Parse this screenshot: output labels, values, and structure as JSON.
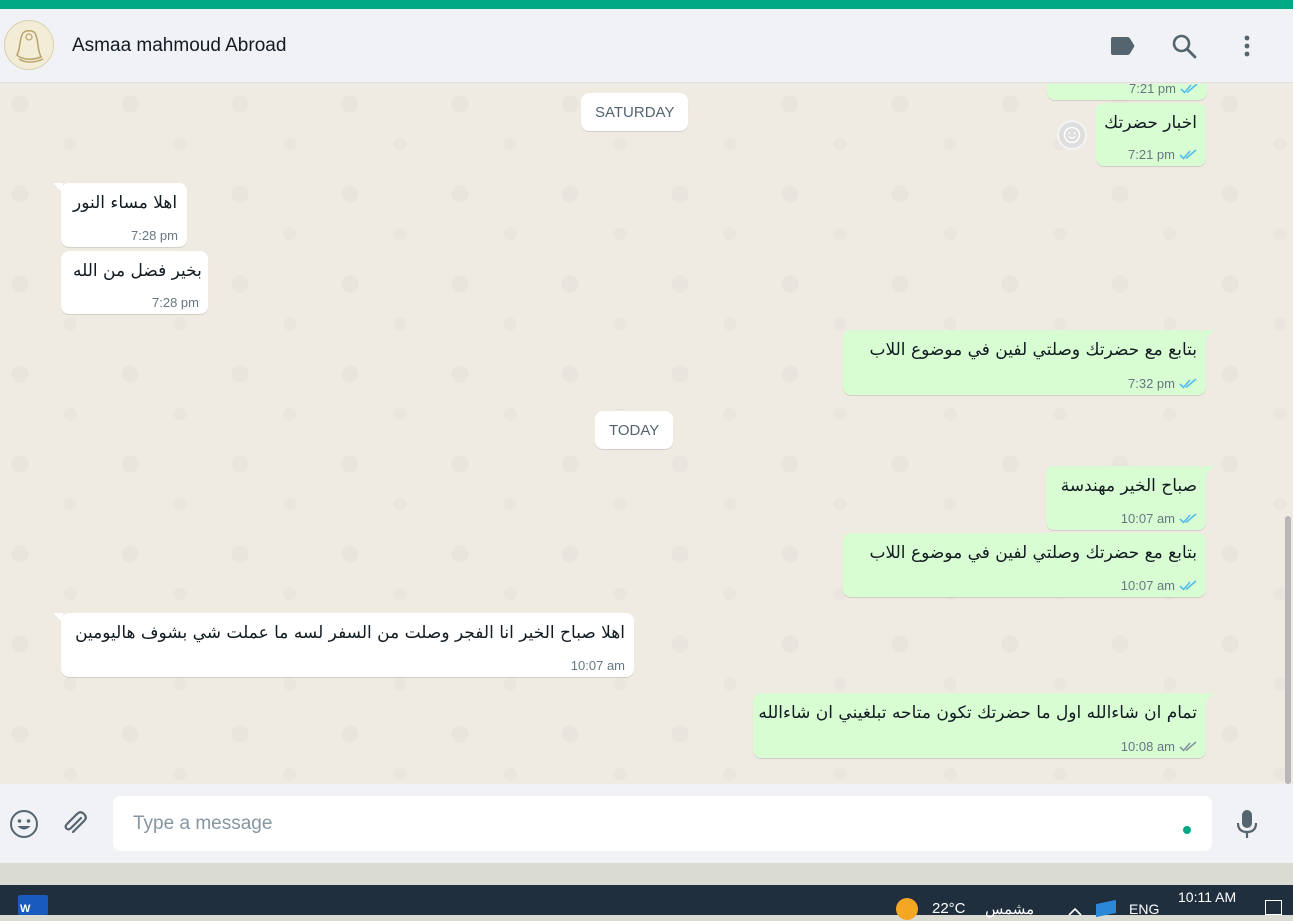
{
  "header": {
    "contact_name": "Asmaa mahmoud Abroad"
  },
  "chat": {
    "partial_time": "7:21 pm",
    "day_separators": [
      "SATURDAY",
      "TODAY"
    ],
    "messages": [
      {
        "dir": "out",
        "text": "اخبار حضرتك",
        "time": "7:21 pm",
        "status": "read"
      },
      {
        "dir": "in",
        "text": "اهلا مساء النور",
        "time": "7:28 pm"
      },
      {
        "dir": "in",
        "text": "بخير فضل من الله",
        "time": "7:28 pm"
      },
      {
        "dir": "out",
        "text": "بتابع مع حضرتك وصلتي لفين في موضوع اللاب",
        "time": "7:32 pm",
        "status": "read"
      },
      {
        "dir": "out",
        "text": "صباح الخير مهندسة",
        "time": "10:07 am",
        "status": "read"
      },
      {
        "dir": "out",
        "text": "بتابع مع حضرتك وصلتي لفين في موضوع اللاب",
        "time": "10:07 am",
        "status": "read"
      },
      {
        "dir": "in",
        "text": "اهلا صباح الخير انا الفجر وصلت من السفر لسه ما عملت شي بشوف هاليومين",
        "time": "10:07 am"
      },
      {
        "dir": "out",
        "text": "تمام ان شاءالله اول ما حضرتك تكون متاحه تبلغيني ان شاءالله",
        "time": "10:08 am",
        "status": "delivered"
      }
    ]
  },
  "composer": {
    "placeholder": "Type a message"
  },
  "taskbar": {
    "temperature": "22°C",
    "weather": "مشمس",
    "language": "ENG",
    "time": "10:11 AM"
  },
  "colors": {
    "accent": "#00a884",
    "incoming_bubble": "#ffffff",
    "outgoing_bubble": "#d9fdd3",
    "read_ticks": "#53bdeb",
    "delivered_ticks": "#8696a0"
  }
}
